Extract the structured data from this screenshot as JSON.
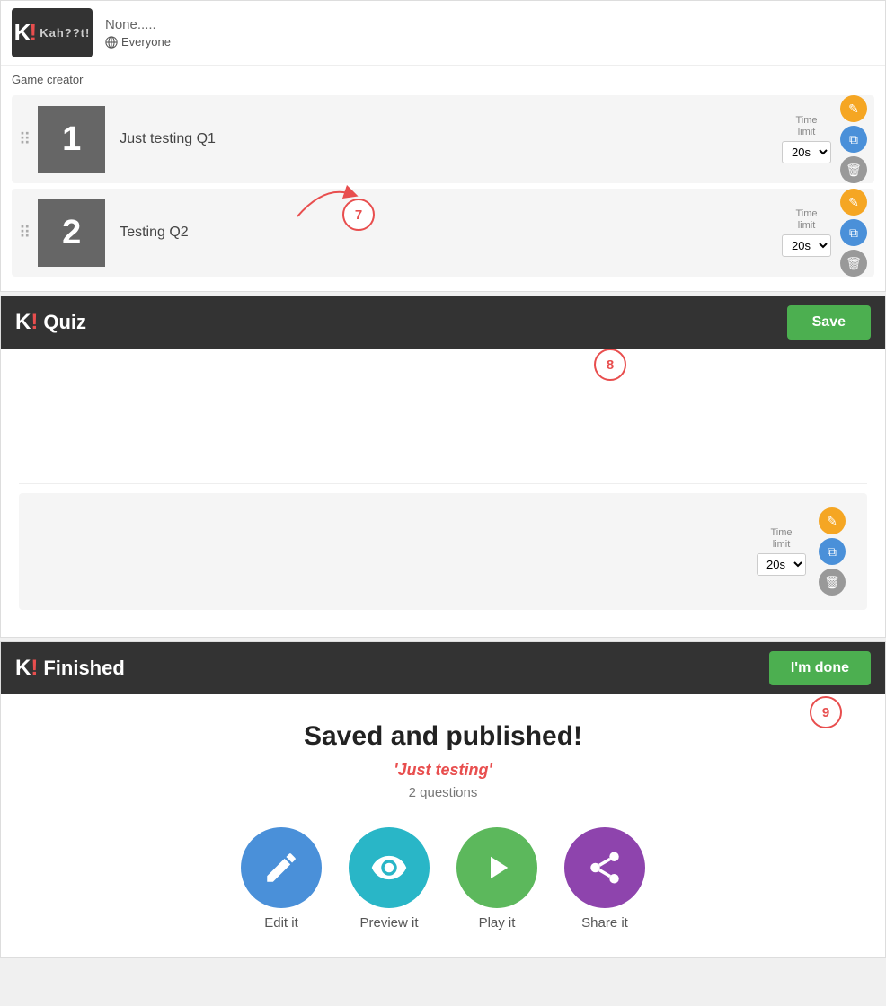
{
  "logo": {
    "text": "Kah??t!",
    "k": "K",
    "bang": "!"
  },
  "top": {
    "none_text": "None.....",
    "everyone": "Everyone",
    "game_creator": "Game creator",
    "questions": [
      {
        "number": "1",
        "title": "Just testing Q1",
        "time_label": "Time\nlimit",
        "time_value": "20s"
      },
      {
        "number": "2",
        "title": "Testing Q2",
        "time_label": "Time\nlimit",
        "time_value": "20s"
      }
    ]
  },
  "quiz_section": {
    "title": "Quiz",
    "save_label": "Save",
    "time_label": "Time\nlimit",
    "time_value": "20s"
  },
  "finished_section": {
    "title": "Finished",
    "done_label": "I'm done",
    "heading": "Saved and published!",
    "quiz_name": "'Just testing'",
    "questions_count": "2 questions",
    "actions": [
      {
        "id": "edit",
        "label": "Edit it",
        "color": "circle-blue"
      },
      {
        "id": "preview",
        "label": "Preview it",
        "color": "circle-teal"
      },
      {
        "id": "play",
        "label": "Play it",
        "color": "circle-green"
      },
      {
        "id": "share",
        "label": "Share it",
        "color": "circle-purple"
      }
    ]
  },
  "annotations": {
    "seven": "7",
    "eight": "8",
    "nine": "9"
  }
}
